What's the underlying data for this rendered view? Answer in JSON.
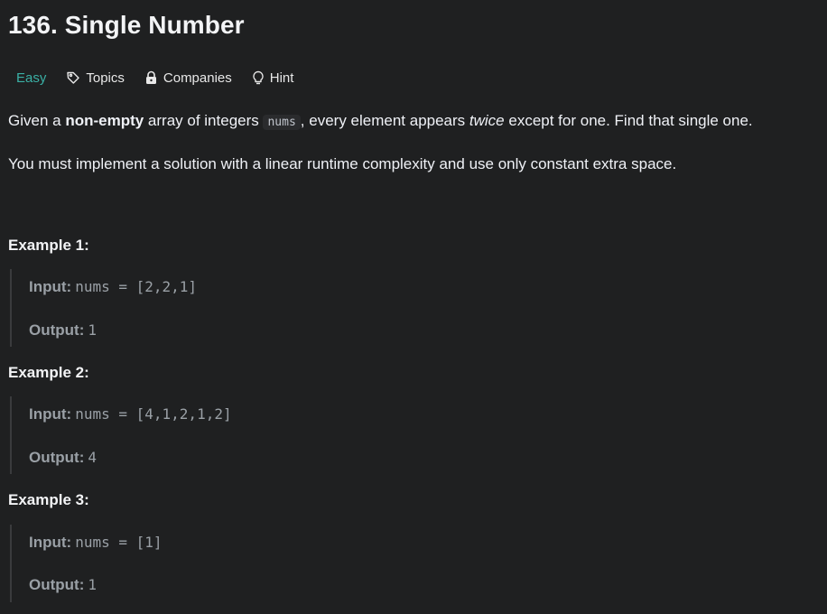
{
  "problem": {
    "title": "136. Single Number",
    "difficulty": "Easy",
    "tags": {
      "topics": "Topics",
      "companies": "Companies",
      "hint": "Hint"
    },
    "description": {
      "p1_pre": "Given a ",
      "p1_bold": "non-empty",
      "p1_mid": " array of integers ",
      "p1_code": "nums",
      "p1_mid2": ", every element appears ",
      "p1_italic": "twice",
      "p1_post": " except for one. Find that single one.",
      "p2": "You must implement a solution with a linear runtime complexity and use only constant extra space."
    },
    "examples": [
      {
        "title": "Example 1:",
        "input_label": "Input:",
        "input_value": "nums = [2,2,1]",
        "output_label": "Output:",
        "output_value": "1"
      },
      {
        "title": "Example 2:",
        "input_label": "Input:",
        "input_value": "nums = [4,1,2,1,2]",
        "output_label": "Output:",
        "output_value": "4"
      },
      {
        "title": "Example 3:",
        "input_label": "Input:",
        "input_value": "nums = [1]",
        "output_label": "Output:",
        "output_value": "1"
      }
    ]
  },
  "icons": {
    "topics": "tag-icon",
    "companies": "lock-icon",
    "hint": "lightbulb-icon"
  },
  "colors": {
    "background": "#1f2021",
    "easy": "#3ab0a5",
    "text": "#eff1f6",
    "muted": "#9aa0a6"
  }
}
